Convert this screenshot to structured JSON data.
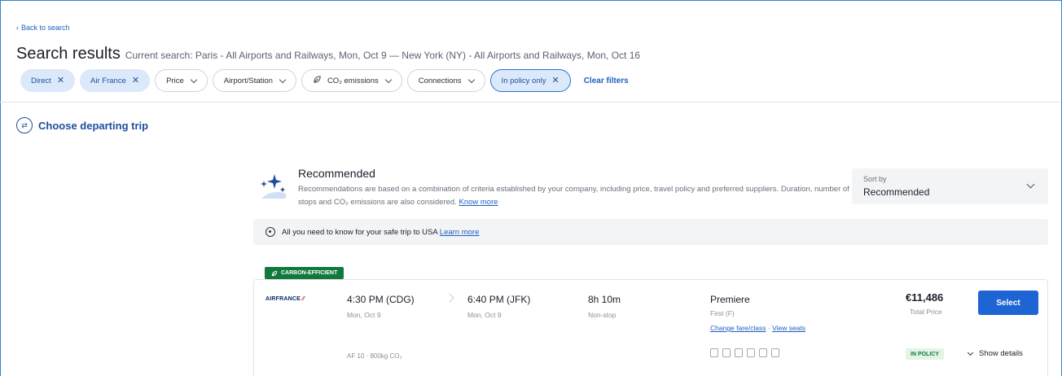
{
  "header": {
    "back_label": "Back to search",
    "title": "Search results",
    "current_search": "Current search: Paris - All Airports and Railways, Mon, Oct 9 — New York (NY) - All Airports and Railways, Mon, Oct 16"
  },
  "filters": {
    "chips": [
      {
        "label": "Direct",
        "state": "active"
      },
      {
        "label": "Air France",
        "state": "active"
      },
      {
        "label": "Price",
        "state": "dropdown"
      },
      {
        "label": "Airport/Station",
        "state": "dropdown"
      },
      {
        "label": "CO₂ emissions",
        "state": "dropdown"
      },
      {
        "label": "Connections",
        "state": "dropdown"
      },
      {
        "label": "In policy only",
        "state": "active"
      }
    ],
    "clear_label": "Clear filters"
  },
  "departing": {
    "label": "Choose departing trip"
  },
  "recommended": {
    "title": "Recommended",
    "description": "Recommendations are based on a combination of criteria established by your company, including price, travel policy and preferred suppliers. Duration, number of stops and CO₂ emissions are also considered.",
    "link": "Know more"
  },
  "sort": {
    "label": "Sort by",
    "value": "Recommended"
  },
  "safe_banner": {
    "text": "All you need to know for your safe trip to USA",
    "link": "Learn more"
  },
  "flight": {
    "badge": "CARBON-EFFICIENT",
    "airline": "AIRFRANCE",
    "departure": {
      "time": "4:30 PM (CDG)",
      "date": "Mon, Oct 9"
    },
    "arrival": {
      "time": "6:40 PM (JFK)",
      "date": "Mon, Oct 9"
    },
    "duration": "8h 10m",
    "stops": "Non-stop",
    "fare": {
      "name": "Premiere",
      "class": "First (F)",
      "change_link": "Change fare/class",
      "separator": "·",
      "seats_link": "View seats"
    },
    "price": "€11,486",
    "price_label": "Total Price",
    "select_label": "Select",
    "meta": "AF 10 · 800kg CO₂",
    "policy_badge": "IN POLICY",
    "show_details": "Show details"
  },
  "colors": {
    "accent": "#1f64d3",
    "link": "#1f5fbf",
    "carbon_green": "#107a3d",
    "chip_active_bg": "#dbe9fb"
  }
}
